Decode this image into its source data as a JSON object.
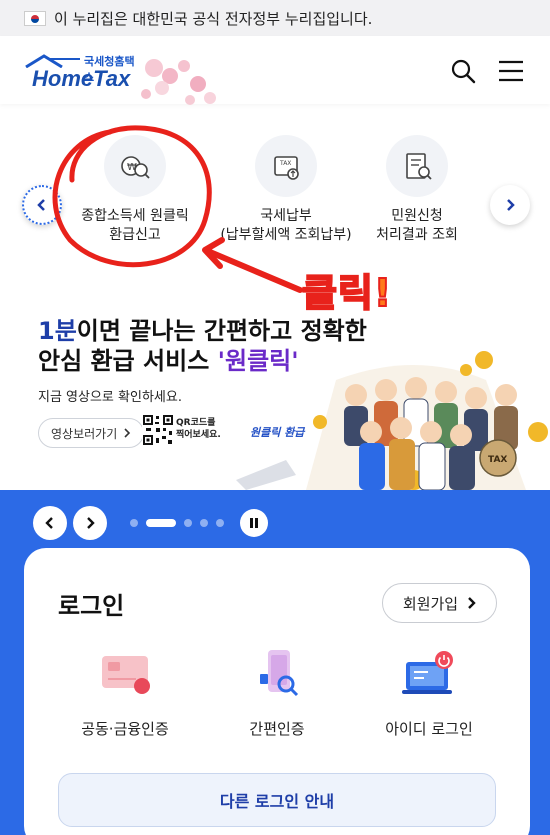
{
  "gov_banner": {
    "text": "이 누리집은 대한민국 공식 전자정부 누리집입니다."
  },
  "header": {
    "logo_sub": "국세청홈택스",
    "logo_main": "HomeTax",
    "icons": [
      "search-icon",
      "menu-icon"
    ]
  },
  "services": [
    {
      "line1": "종합소득세 원클릭",
      "line2": "환급신고",
      "icon": "refund-icon"
    },
    {
      "line1": "국세납부",
      "line2": "(납부할세액 조회납부)",
      "icon": "tax-payment-icon"
    },
    {
      "line1": "민원신청",
      "line2": "처리결과 조회",
      "icon": "document-search-icon"
    }
  ],
  "annotation": {
    "text": "클릭!",
    "color": "#e8221b"
  },
  "banner": {
    "line1_highlight": "1분",
    "line1_rest": "이면 끝나는 간편하고 정확한",
    "line2_pre": "안심 환급 서비스 ",
    "line2_highlight": "'원클릭'",
    "sub": "지금 영상으로 확인하세요.",
    "video_button": "영상보러가기",
    "qr_text_1": "QR코드를",
    "qr_text_2": "찍어보세요.",
    "tag": "원클릭 환급",
    "crowd_badge": "TAX"
  },
  "carousel": {
    "slide_count": 5,
    "active_index": 1
  },
  "login": {
    "title": "로그인",
    "signup": "회원가입",
    "options": [
      {
        "label": "공동·금융인증",
        "icon": "certificate-card-icon"
      },
      {
        "label": "간편인증",
        "icon": "mobile-auth-icon"
      },
      {
        "label": "아이디 로그인",
        "icon": "id-login-icon"
      }
    ],
    "other": "다른 로그인 안내"
  },
  "colors": {
    "primary_blue": "#2c6ae6",
    "brand_navy": "#1a4fae",
    "annotation_red": "#e8221b"
  }
}
